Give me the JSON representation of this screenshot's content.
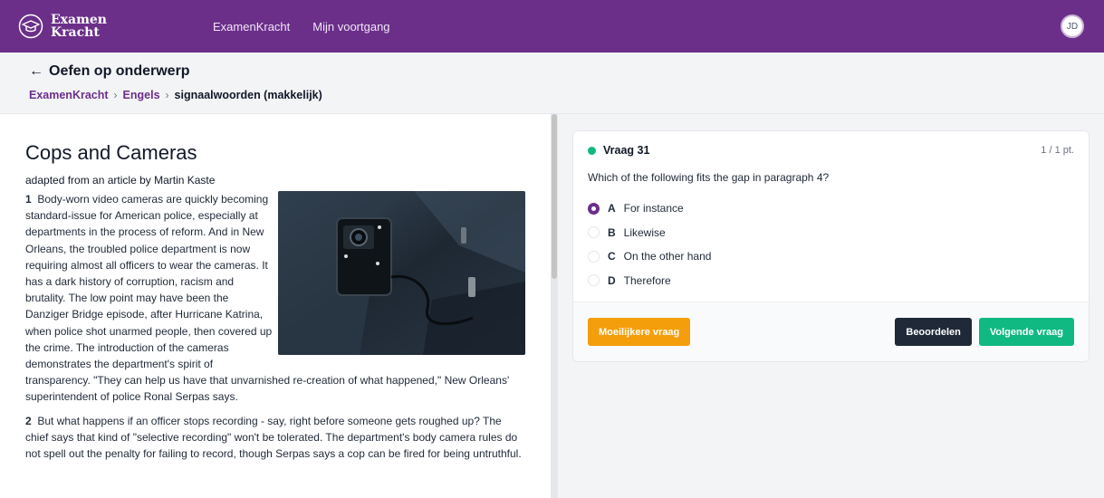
{
  "nav": {
    "logo_line1": "Examen",
    "logo_line2": "Kracht",
    "links": [
      "ExamenKracht",
      "Mijn voortgang"
    ],
    "avatar_initials": "JD",
    "brand_color": "#6b2f8a"
  },
  "header": {
    "back_label": "Oefen op onderwerp",
    "breadcrumbs": [
      "ExamenKracht",
      "Engels",
      "signaalwoorden (makkelijk)"
    ]
  },
  "article": {
    "title": "Cops and Cameras",
    "byline": "adapted from an article by Martin Kaste",
    "p1_num": "1",
    "p1_text": "Body-worn video cameras are quickly becoming standard-issue for American police, especially at departments in the process of reform. And in New Orleans, the troubled police department is now requiring almost all officers to wear the cameras. It has a dark history of corruption, racism and brutality. The low point may have been the Danziger Bridge episode, after Hurricane Katrina, when police shot unarmed people, then covered up the crime.",
    "p1_cont": "The introduction of the cameras demonstrates the department's spirit of transparency. \"They can help us have that unvarnished re-creation of what happened,\" New Orleans' superintendent of police Ronal Serpas says.",
    "p2_num": "2",
    "p2_text": "But what happens if an officer stops recording - say, right before someone gets roughed up? The chief says that kind of \"selective recording\" won't be tolerated. The department's body camera rules do not spell out the penalty for failing to record, though Serpas says a cop can be fired for being untruthful."
  },
  "question": {
    "label": "Vraag 31",
    "score": "1 / 1 pt.",
    "text": "Which of the following fits the gap in paragraph 4?",
    "options": [
      {
        "letter": "A",
        "text": "For instance",
        "selected": true
      },
      {
        "letter": "B",
        "text": "Likewise",
        "selected": false
      },
      {
        "letter": "C",
        "text": "On the other hand",
        "selected": false
      },
      {
        "letter": "D",
        "text": "Therefore",
        "selected": false
      }
    ],
    "btn_harder": "Moeilijkere vraag",
    "btn_grade": "Beoordelen",
    "btn_next": "Volgende vraag"
  }
}
